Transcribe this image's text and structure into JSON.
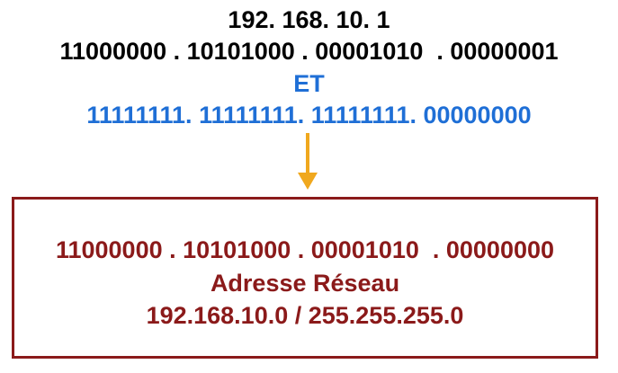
{
  "colors": {
    "input_text": "#000000",
    "operator": "#1f6fd6",
    "mask_binary_lead": "#1f6fd6",
    "mask_binary_tail": "#1f6fd6",
    "arrow": "#f0a81e",
    "result": "#8b1a1a"
  },
  "input": {
    "ip_decimal": "192. 168. 10. 1",
    "ip_binary": "11000000 . 10101000 . 00001010  . 00000001"
  },
  "operator": "ET",
  "mask": {
    "binary_lead": "11111111. 11111111. 11111111. ",
    "binary_tail": "00000000"
  },
  "arrow_icon": "down-arrow-icon",
  "result": {
    "binary": "11000000 . 10101000 . 00001010  . 00000000",
    "label": "Adresse Réseau",
    "network": "192.168.10.0 / 255.255.255.0"
  }
}
